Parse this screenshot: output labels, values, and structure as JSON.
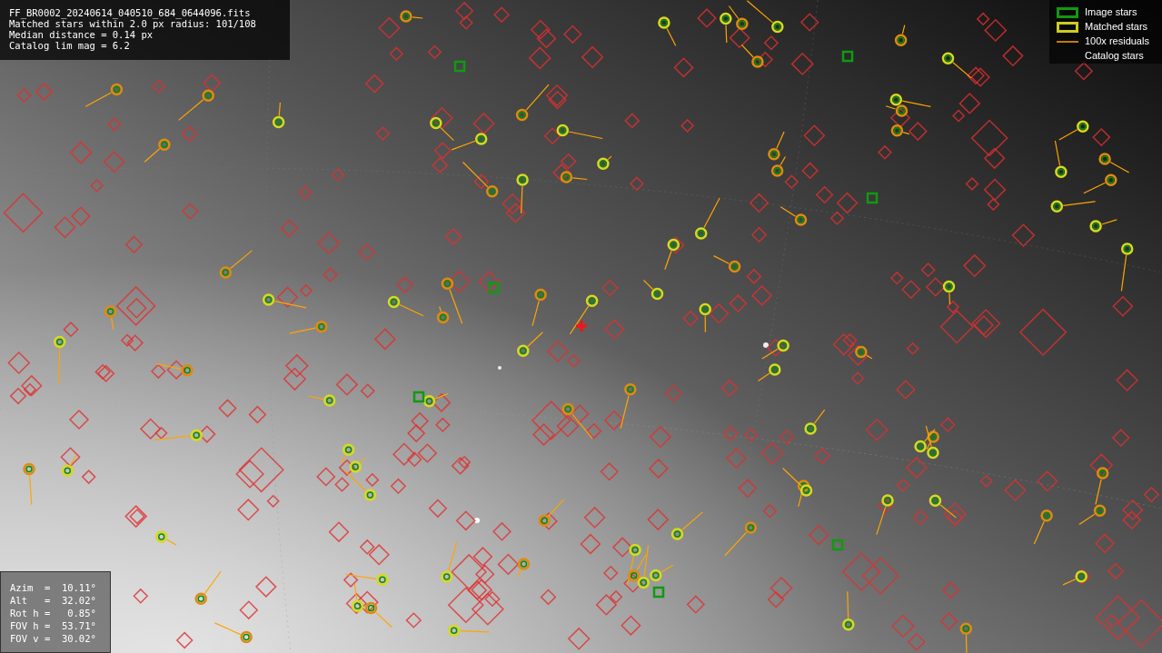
{
  "info_box": {
    "lines": [
      "FF_BR0002_20240614_040510_684_0644096.fits",
      "Matched stars within 2.0 px radius: 101/108",
      "Median distance = 0.14 px",
      "Catalog lim mag = 6.2"
    ]
  },
  "legend": [
    {
      "label": "Image stars"
    },
    {
      "kind": "matched",
      "label": "Matched stars"
    },
    {
      "kind": "residual",
      "label": "100x residuals"
    },
    {
      "kind": "catalog",
      "label": "Catalog stars"
    }
  ],
  "pointing": {
    "lines": [
      "Azim  =  10.11°",
      "Alt   =  32.02°",
      "Rot h =   0.85°",
      "FOV h =  53.71°",
      "FOV v =  30.02°"
    ]
  }
}
